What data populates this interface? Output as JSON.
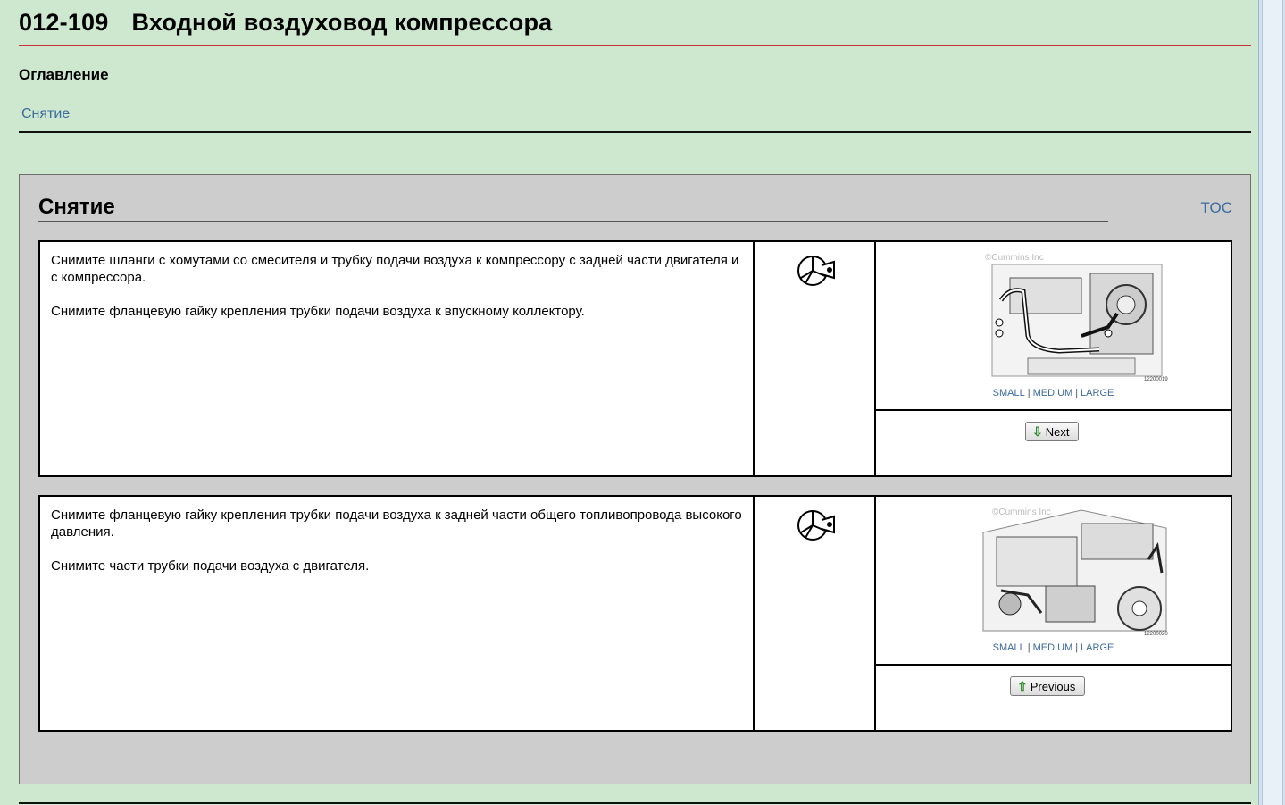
{
  "page": {
    "number": "012-109",
    "title": "Входной воздуховод компрессора"
  },
  "toc": {
    "heading": "Оглавление",
    "links": [
      "Снятие"
    ]
  },
  "section": {
    "title": "Снятие",
    "toc_link": "TOC"
  },
  "steps": [
    {
      "paragraphs": [
        "Снимите шланги с хомутами со смесителя и трубку подачи воздуха к компрессору с задней части двигателя и с компрессора.",
        "Снимите фланцевую гайку крепления трубки подачи воздуха к впускному коллектору."
      ],
      "icon": "remove-tool-icon",
      "image": {
        "watermark": "©Cummins Inc",
        "code": "12200019",
        "sizes": [
          "SMALL",
          "MEDIUM",
          "LARGE"
        ],
        "separator": "|"
      },
      "nav_button": "Next"
    },
    {
      "paragraphs": [
        "Снимите фланцевую гайку крепления трубки подачи воздуха к задней части общего топливопровода высокого давления.",
        "Снимите части трубки подачи воздуха с двигателя."
      ],
      "icon": "remove-tool-icon",
      "image": {
        "watermark": "©Cummins Inc",
        "code": "12200020",
        "sizes": [
          "SMALL",
          "MEDIUM",
          "LARGE"
        ],
        "separator": "|"
      },
      "nav_button": "Previous"
    }
  ]
}
